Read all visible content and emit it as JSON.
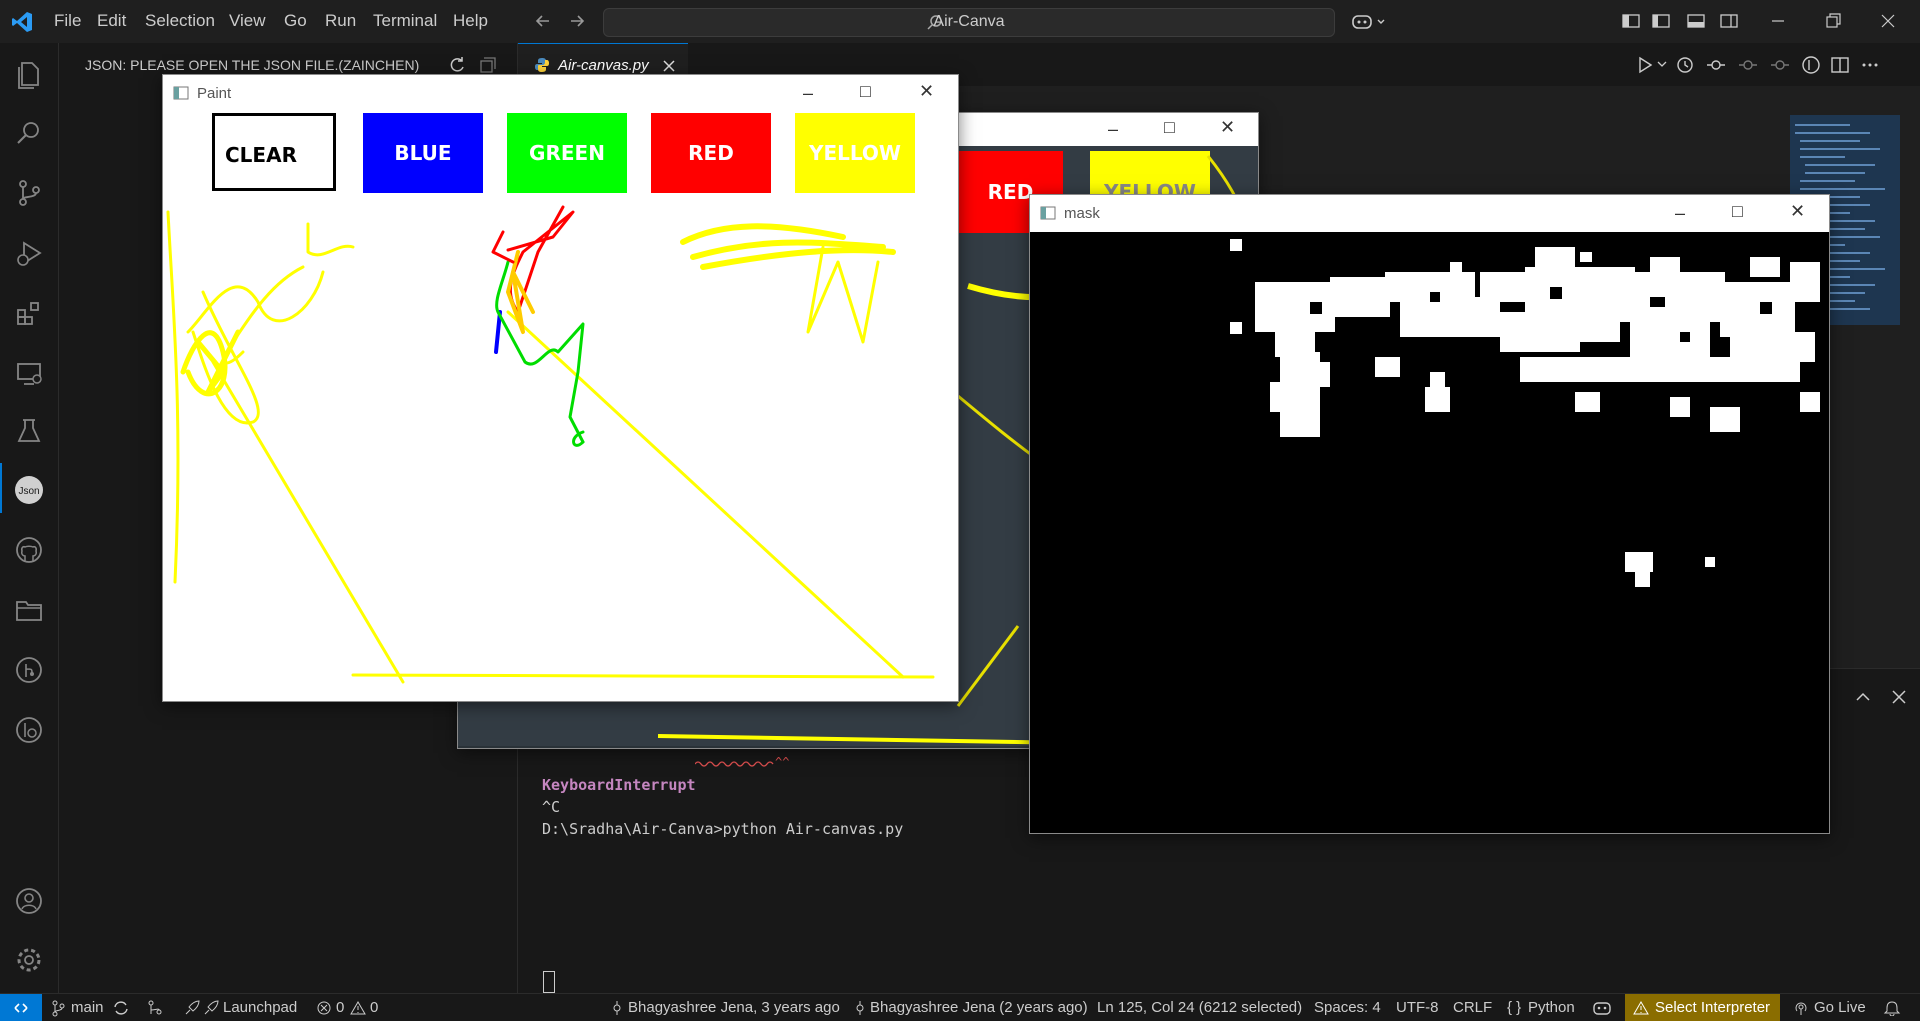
{
  "titlebar": {
    "menu": [
      "File",
      "Edit",
      "Selection",
      "View",
      "Go",
      "Run",
      "Terminal",
      "Help"
    ],
    "search_text": "Air-Canva"
  },
  "sidebar": {
    "title": "JSON: PLEASE OPEN THE JSON FILE.(ZAINCHEN)"
  },
  "editor": {
    "tab_label": "Air-canvas.py"
  },
  "terminal": {
    "error_text": "KeyboardInterrupt",
    "lines": [
      "^C",
      "D:\\Sradha\\Air-Canva>python Air-canvas.py"
    ]
  },
  "paint_window": {
    "title": "Paint",
    "buttons": [
      "CLEAR",
      "BLUE",
      "GREEN",
      "RED",
      "YELLOW"
    ]
  },
  "frame_window": {
    "buttons": [
      "RED",
      "YELLOW"
    ]
  },
  "mask_window": {
    "title": "mask"
  },
  "statusbar": {
    "branch": "main",
    "launchpad": "Launchpad",
    "errors": "0",
    "warnings": "0",
    "blame1": "Bhagyashree Jena, 3 years ago",
    "blame2": "Bhagyashree Jena (2 years ago)",
    "cursor": "Ln 125, Col 24 (6212 selected)",
    "spaces": "Spaces: 4",
    "encoding": "UTF-8",
    "eol": "CRLF",
    "language": "Python",
    "interpreter": "Select Interpreter",
    "golive": "Go Live"
  },
  "colors": {
    "accent": "#0078d4",
    "blue": "#0000ff",
    "green": "#00ff00",
    "red": "#ff0000",
    "yellow": "#ffff00",
    "error_text": "#c586c0",
    "interpreter_bg": "#8a6d00"
  }
}
